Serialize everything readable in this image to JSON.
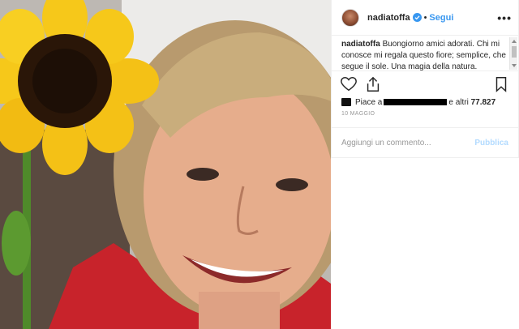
{
  "post": {
    "username": "nadiatoffa",
    "separator": "•",
    "follow_label": "Segui",
    "more_label": "•••",
    "caption_user": "nadiatoffa",
    "caption_text": "Buongiorno amici adorati. Chi mi conosce mi regala questo fiore; semplice, che segue il sole. Una magia della natura. Pensierino",
    "likes_prefix": "Piace a",
    "likes_suffix": "e altri",
    "likes_count": "77.827",
    "date": "10 MAGGIO",
    "comment_placeholder": "Aggiungi un commento...",
    "publish_label": "Pubblica"
  },
  "colors": {
    "link": "#3897f0",
    "publish_disabled": "#b3dbff",
    "verified": "#3897f0"
  }
}
